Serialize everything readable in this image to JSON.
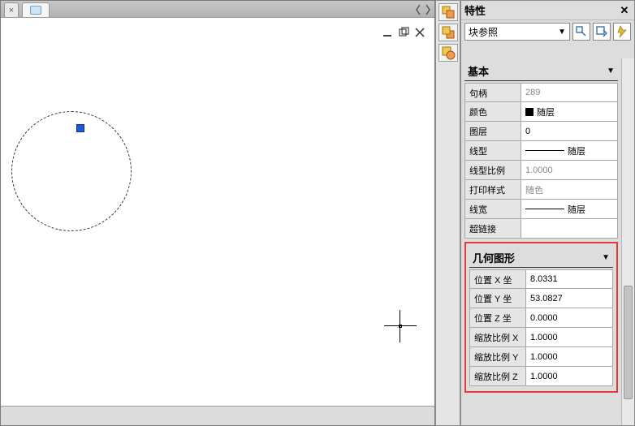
{
  "panel": {
    "title": "特性",
    "close": "x",
    "selector": "块参照"
  },
  "sections": {
    "basic": {
      "title": "基本",
      "rows": {
        "handle": {
          "label": "句柄",
          "value": "289"
        },
        "color": {
          "label": "颜色",
          "value": "随层"
        },
        "layer": {
          "label": "图层",
          "value": "0"
        },
        "ltype": {
          "label": "线型",
          "value": "随层"
        },
        "lscale": {
          "label": "线型比例",
          "value": "1.0000"
        },
        "pstyle": {
          "label": "打印样式",
          "value": "随色"
        },
        "lweight": {
          "label": "线宽",
          "value": "随层"
        },
        "hlink": {
          "label": "超链接",
          "value": ""
        }
      }
    },
    "geom": {
      "title": "几何图形",
      "rows": {
        "px": {
          "label": "位置 X 坐",
          "value": "8.0331"
        },
        "py": {
          "label": "位置 Y 坐",
          "value": "53.0827"
        },
        "pz": {
          "label": "位置 Z 坐",
          "value": "0.0000"
        },
        "sx": {
          "label": "缩放比例 X",
          "value": "1.0000"
        },
        "sy": {
          "label": "缩放比例 Y",
          "value": "1.0000"
        },
        "sz": {
          "label": "缩放比例 Z",
          "value": "1.0000"
        }
      }
    }
  }
}
